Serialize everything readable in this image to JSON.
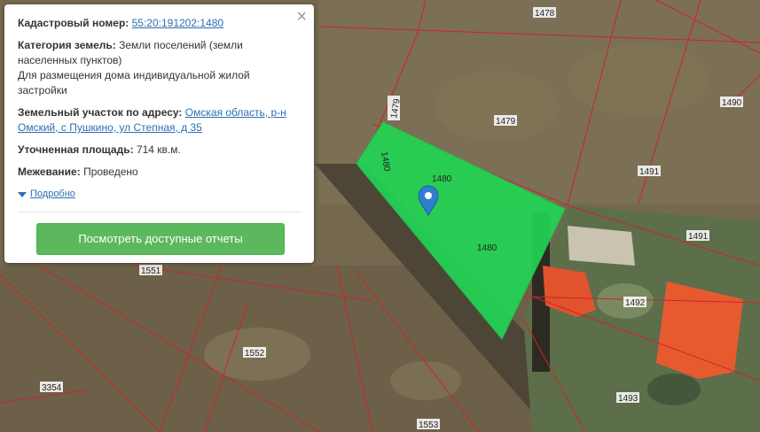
{
  "popup": {
    "cadastral_label": "Кадастровый номер:",
    "cadastral_number": "55:20:191202:1480",
    "land_category_label": "Категория земель:",
    "land_category_value": "Земли поселений (земли населенных пунктов)",
    "permitted_use": "Для размещения дома индивидуальной жилой застройки",
    "address_label": "Земельный участок по адресу:",
    "address_value": "Омская область, р-н Омский, с Пушкино, ул Степная, д 35",
    "area_label": "Уточненная площадь:",
    "area_value": "714 кв.м.",
    "survey_label": "Межевание:",
    "survey_value": "Проведено",
    "details_link": "Подробно",
    "reports_button": "Посмотреть доступные отчеты",
    "close_symbol": "×"
  },
  "map": {
    "parcel_labels": {
      "p1478": "1478",
      "p1479": "1479",
      "p1479_edge": "1479",
      "p1480_a": "1480",
      "p1480_b": "1480",
      "p1480_c": "1480",
      "p1490": "1490",
      "p1491_a": "1491",
      "p1491_b": "1491",
      "p1492": "1492",
      "p1493": "1493",
      "p1551": "1551",
      "p1552": "1552",
      "p1553": "1553",
      "p3354": "3354"
    },
    "selected_parcel_color": "#22d454",
    "boundary_color": "#d0232a",
    "marker_color": "#2f7fd1",
    "marker_icon": "map-pin-icon"
  }
}
